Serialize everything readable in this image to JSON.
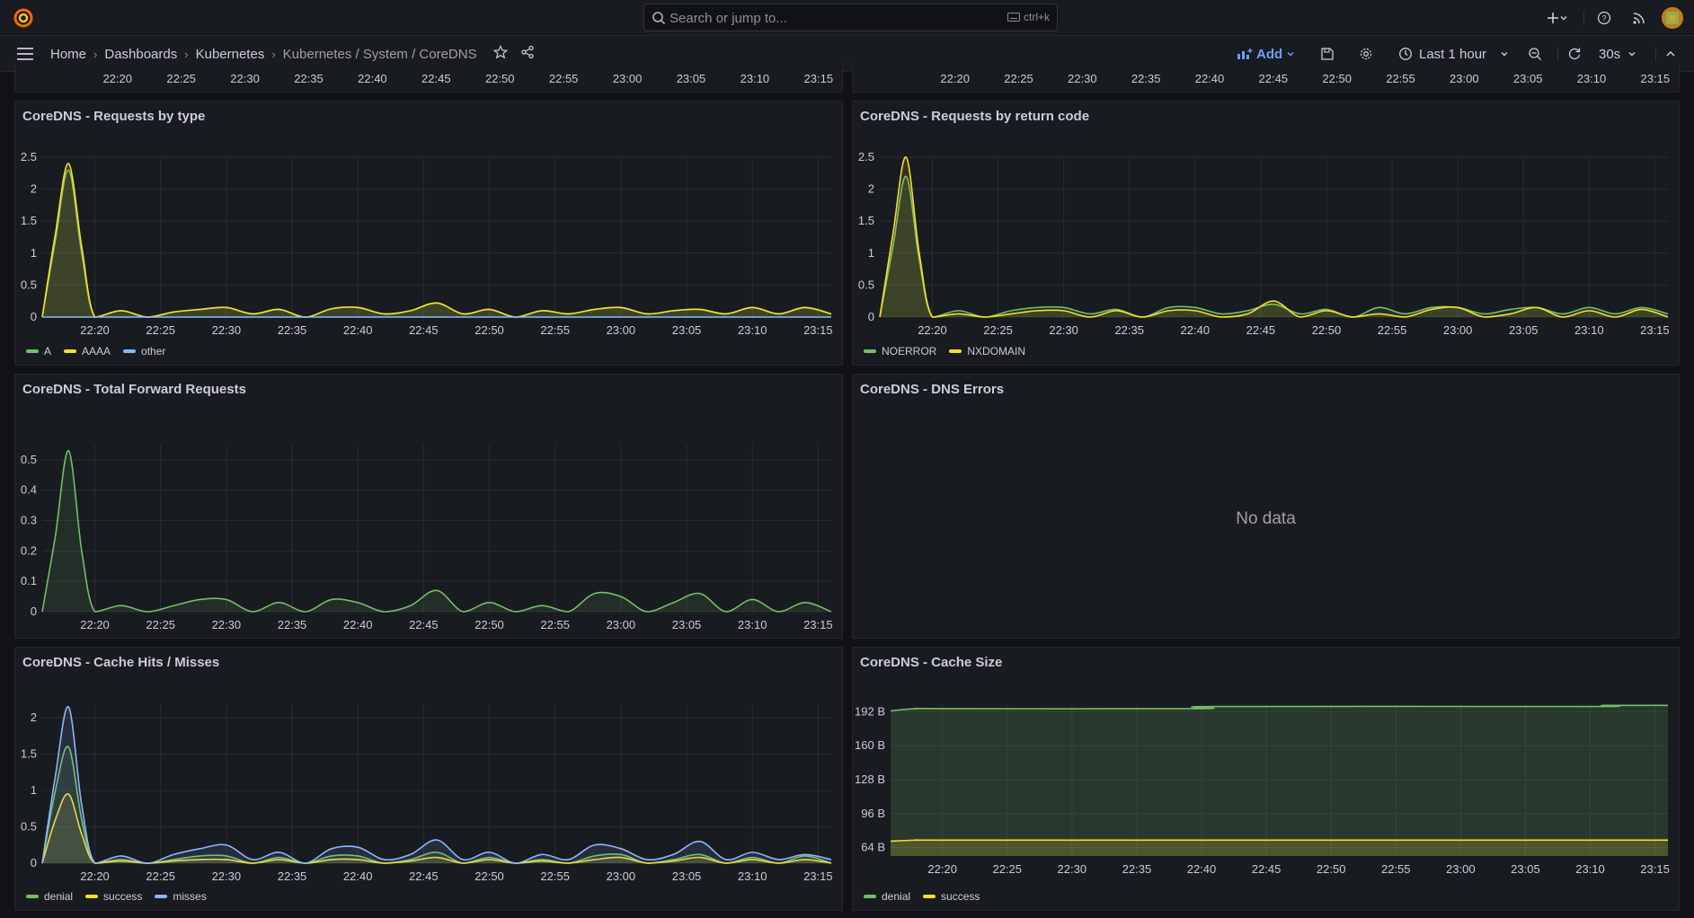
{
  "topbar": {
    "search_placeholder": "Search or jump to...",
    "search_shortcut": "ctrl+k",
    "icons": [
      "grafana-logo-icon",
      "search-icon",
      "keyboard-icon",
      "plus-icon",
      "chevron-down-icon",
      "help-icon",
      "rss-icon",
      "avatar"
    ]
  },
  "breadcrumb": {
    "items": [
      "Home",
      "Dashboards",
      "Kubernetes"
    ],
    "current": "Kubernetes / System / CoreDNS"
  },
  "toolbar": {
    "add_label": "Add",
    "time_range": "Last 1 hour",
    "refresh_interval": "30s"
  },
  "colors": {
    "green": "#73bf69",
    "yellow": "#fade2a",
    "blue": "#8ab8ff",
    "bg": "#111217",
    "panel": "#181b1f"
  },
  "time_ticks": [
    "22:20",
    "22:25",
    "22:30",
    "22:35",
    "22:40",
    "22:45",
    "22:50",
    "22:55",
    "23:00",
    "23:05",
    "23:10",
    "23:15"
  ],
  "panels": {
    "requests_by_type": {
      "title": "CoreDNS - Requests by type",
      "legend": [
        "A",
        "AAAA",
        "other"
      ]
    },
    "requests_by_rcode": {
      "title": "CoreDNS - Requests by return code",
      "legend": [
        "NOERROR",
        "NXDOMAIN"
      ]
    },
    "forward_requests": {
      "title": "CoreDNS - Total Forward Requests"
    },
    "dns_errors": {
      "title": "CoreDNS - DNS Errors",
      "no_data": "No data"
    },
    "cache_hits": {
      "title": "CoreDNS - Cache Hits / Misses",
      "legend": [
        "denial",
        "success",
        "misses"
      ]
    },
    "cache_size": {
      "title": "CoreDNS - Cache Size",
      "legend": [
        "denial",
        "success"
      ]
    }
  },
  "chart_data": [
    {
      "type": "line",
      "title": "CoreDNS - Requests by type",
      "x": [
        "22:16",
        "22:17",
        "22:18",
        "22:19",
        "22:20",
        "22:22",
        "22:24",
        "22:26",
        "22:28",
        "22:30",
        "22:32",
        "22:34",
        "22:36",
        "22:38",
        "22:40",
        "22:42",
        "22:44",
        "22:46",
        "22:48",
        "22:50",
        "22:52",
        "22:54",
        "22:56",
        "22:58",
        "23:00",
        "23:02",
        "23:04",
        "23:06",
        "23:08",
        "23:10",
        "23:12",
        "23:14",
        "23:16"
      ],
      "ylim": [
        0,
        2.5
      ],
      "yticks": [
        "0",
        "0.5",
        "1",
        "1.5",
        "2",
        "2.5"
      ],
      "series": [
        {
          "name": "A",
          "color": "#73bf69",
          "values": [
            0,
            1.2,
            2.3,
            1.0,
            0,
            0.1,
            0,
            0.08,
            0.12,
            0.15,
            0.05,
            0.12,
            0,
            0.13,
            0.15,
            0.05,
            0.1,
            0.22,
            0.05,
            0.12,
            0,
            0.1,
            0.05,
            0.12,
            0.15,
            0.05,
            0.1,
            0.12,
            0.05,
            0.15,
            0.05,
            0.15,
            0.05
          ]
        },
        {
          "name": "AAAA",
          "color": "#fade2a",
          "values": [
            0,
            1.3,
            2.4,
            1.1,
            0,
            0.1,
            0,
            0.08,
            0.12,
            0.15,
            0.05,
            0.12,
            0,
            0.13,
            0.15,
            0.05,
            0.1,
            0.22,
            0.05,
            0.12,
            0,
            0.1,
            0.05,
            0.12,
            0.15,
            0.05,
            0.1,
            0.12,
            0.05,
            0.15,
            0.05,
            0.15,
            0.05
          ]
        },
        {
          "name": "other",
          "color": "#8ab8ff",
          "values": [
            0,
            0,
            0,
            0,
            0,
            0,
            0,
            0,
            0,
            0,
            0,
            0,
            0,
            0,
            0,
            0,
            0,
            0,
            0,
            0,
            0,
            0,
            0,
            0,
            0,
            0,
            0,
            0,
            0,
            0,
            0,
            0,
            0
          ]
        }
      ]
    },
    {
      "type": "line",
      "title": "CoreDNS - Requests by return code",
      "x": [
        "22:16",
        "22:17",
        "22:18",
        "22:19",
        "22:20",
        "22:22",
        "22:24",
        "22:26",
        "22:28",
        "22:30",
        "22:32",
        "22:34",
        "22:36",
        "22:38",
        "22:40",
        "22:42",
        "22:44",
        "22:46",
        "22:48",
        "22:50",
        "22:52",
        "22:54",
        "22:56",
        "22:58",
        "23:00",
        "23:02",
        "23:04",
        "23:06",
        "23:08",
        "23:10",
        "23:12",
        "23:14",
        "23:16"
      ],
      "ylim": [
        0,
        2.5
      ],
      "yticks": [
        "0",
        "0.5",
        "1",
        "1.5",
        "2",
        "2.5"
      ],
      "series": [
        {
          "name": "NOERROR",
          "color": "#73bf69",
          "values": [
            0,
            1.1,
            2.2,
            0.9,
            0,
            0.1,
            0,
            0.1,
            0.15,
            0.15,
            0.05,
            0.12,
            0,
            0.15,
            0.15,
            0.05,
            0.1,
            0.2,
            0.05,
            0.12,
            0,
            0.15,
            0.05,
            0.15,
            0.15,
            0.05,
            0.12,
            0.15,
            0.05,
            0.15,
            0.05,
            0.15,
            0.05
          ]
        },
        {
          "name": "NXDOMAIN",
          "color": "#fade2a",
          "values": [
            0,
            1.3,
            2.5,
            1.0,
            0,
            0.05,
            0,
            0.05,
            0.1,
            0.1,
            0,
            0.1,
            0,
            0.1,
            0.1,
            0,
            0.05,
            0.25,
            0,
            0.1,
            0,
            0.05,
            0,
            0.12,
            0.15,
            0,
            0.05,
            0.15,
            0,
            0.1,
            0,
            0.12,
            0
          ]
        }
      ]
    },
    {
      "type": "area",
      "title": "CoreDNS - Total Forward Requests",
      "x": [
        "22:16",
        "22:17",
        "22:18",
        "22:19",
        "22:20",
        "22:22",
        "22:24",
        "22:26",
        "22:28",
        "22:30",
        "22:32",
        "22:34",
        "22:36",
        "22:38",
        "22:40",
        "22:42",
        "22:44",
        "22:46",
        "22:48",
        "22:50",
        "22:52",
        "22:54",
        "22:56",
        "22:58",
        "23:00",
        "23:02",
        "23:04",
        "23:06",
        "23:08",
        "23:10",
        "23:12",
        "23:14",
        "23:16"
      ],
      "ylim": [
        0,
        0.55
      ],
      "yticks": [
        "0",
        "0.1",
        "0.2",
        "0.3",
        "0.4",
        "0.5"
      ],
      "series": [
        {
          "name": "",
          "color": "#73bf69",
          "values": [
            0,
            0.25,
            0.53,
            0.2,
            0,
            0.02,
            0,
            0.02,
            0.04,
            0.04,
            0,
            0.03,
            0,
            0.04,
            0.03,
            0,
            0.02,
            0.07,
            0,
            0.03,
            0,
            0.02,
            0,
            0.06,
            0.05,
            0,
            0.03,
            0.06,
            0,
            0.04,
            0,
            0.03,
            0
          ]
        }
      ]
    },
    {
      "type": "line",
      "title": "CoreDNS - Cache Hits / Misses",
      "x": [
        "22:16",
        "22:17",
        "22:18",
        "22:19",
        "22:20",
        "22:22",
        "22:24",
        "22:26",
        "22:28",
        "22:30",
        "22:32",
        "22:34",
        "22:36",
        "22:38",
        "22:40",
        "22:42",
        "22:44",
        "22:46",
        "22:48",
        "22:50",
        "22:52",
        "22:54",
        "22:56",
        "22:58",
        "23:00",
        "23:02",
        "23:04",
        "23:06",
        "23:08",
        "23:10",
        "23:12",
        "23:14",
        "23:16"
      ],
      "ylim": [
        0,
        2.2
      ],
      "yticks": [
        "0",
        "0.5",
        "1",
        "1.5",
        "2"
      ],
      "series": [
        {
          "name": "denial",
          "color": "#73bf69",
          "values": [
            0,
            1.0,
            1.6,
            0.6,
            0,
            0.05,
            0,
            0.05,
            0.1,
            0.1,
            0,
            0.08,
            0,
            0.1,
            0.1,
            0,
            0.05,
            0.15,
            0,
            0.08,
            0,
            0.05,
            0,
            0.1,
            0.12,
            0,
            0.05,
            0.12,
            0,
            0.08,
            0,
            0.1,
            0
          ]
        },
        {
          "name": "success",
          "color": "#fade2a",
          "values": [
            0,
            0.6,
            0.95,
            0.4,
            0,
            0.03,
            0,
            0.03,
            0.05,
            0.05,
            0,
            0.05,
            0,
            0.05,
            0.05,
            0,
            0.03,
            0.08,
            0,
            0.05,
            0,
            0.03,
            0,
            0.05,
            0.08,
            0,
            0.03,
            0.08,
            0,
            0.05,
            0,
            0.05,
            0
          ]
        },
        {
          "name": "misses",
          "color": "#8ab8ff",
          "values": [
            0,
            1.2,
            2.15,
            0.8,
            0,
            0.1,
            0,
            0.12,
            0.2,
            0.25,
            0.05,
            0.15,
            0,
            0.2,
            0.22,
            0.05,
            0.12,
            0.32,
            0.05,
            0.15,
            0,
            0.12,
            0.05,
            0.25,
            0.2,
            0.05,
            0.12,
            0.3,
            0.05,
            0.15,
            0.05,
            0.12,
            0.05
          ]
        }
      ]
    },
    {
      "type": "area",
      "title": "CoreDNS - Cache Size",
      "x": [
        "22:16",
        "22:18",
        "22:20",
        "22:40",
        "22:41",
        "23:10",
        "23:11",
        "23:16"
      ],
      "ylim": [
        56,
        200
      ],
      "yticks": [
        "64 B",
        "96 B",
        "128 B",
        "160 B",
        "192 B"
      ],
      "series": [
        {
          "name": "denial",
          "color": "#73bf69",
          "values": [
            193,
            195,
            195,
            195,
            197,
            197,
            198,
            198
          ]
        },
        {
          "name": "success",
          "color": "#fade2a",
          "values": [
            70,
            71,
            71,
            71,
            71,
            71,
            71,
            71
          ]
        }
      ]
    }
  ]
}
